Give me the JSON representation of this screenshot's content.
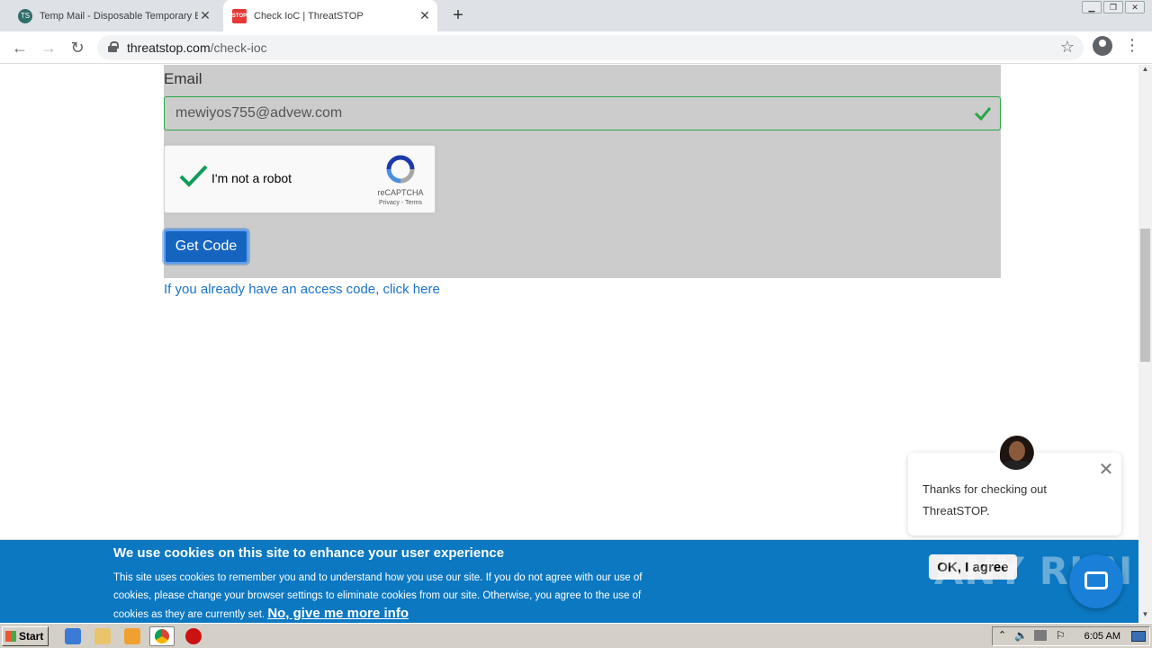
{
  "browser": {
    "tabs": [
      {
        "title": "Temp Mail - Disposable Temporary E",
        "active": false
      },
      {
        "title": "Check IoC | ThreatSTOP",
        "active": true
      }
    ],
    "url_host": "threatstop.com",
    "url_path": "/check-ioc"
  },
  "form": {
    "email_label": "Email",
    "email_value": "mewiyos755@advew.com",
    "recaptcha": {
      "label": "I'm not a robot",
      "brand": "reCAPTCHA",
      "links": "Privacy - Terms",
      "checked": true
    },
    "submit_label": "Get Code",
    "access_link": "If you already have an access code, click here"
  },
  "chat": {
    "message": "Thanks for checking out ThreatSTOP."
  },
  "cookie_banner": {
    "title": "We use cookies on this site to enhance your user experience",
    "body": "This site uses cookies to remember you and to understand how you use our site. If you do not agree with our use of cookies, please change your browser settings to eliminate cookies from our site. Otherwise, you agree to the use of cookies as they are currently set.",
    "more_link": "No, give me more info",
    "ok_label": "OK, I agree"
  },
  "watermark": "ANY RUN",
  "taskbar": {
    "start_label": "Start",
    "clock": "6:05 AM"
  },
  "colors": {
    "accent_blue": "#1565c0",
    "banner_blue": "#0b78c1",
    "success_green": "#28a745",
    "panel_grey": "#cccccc"
  }
}
